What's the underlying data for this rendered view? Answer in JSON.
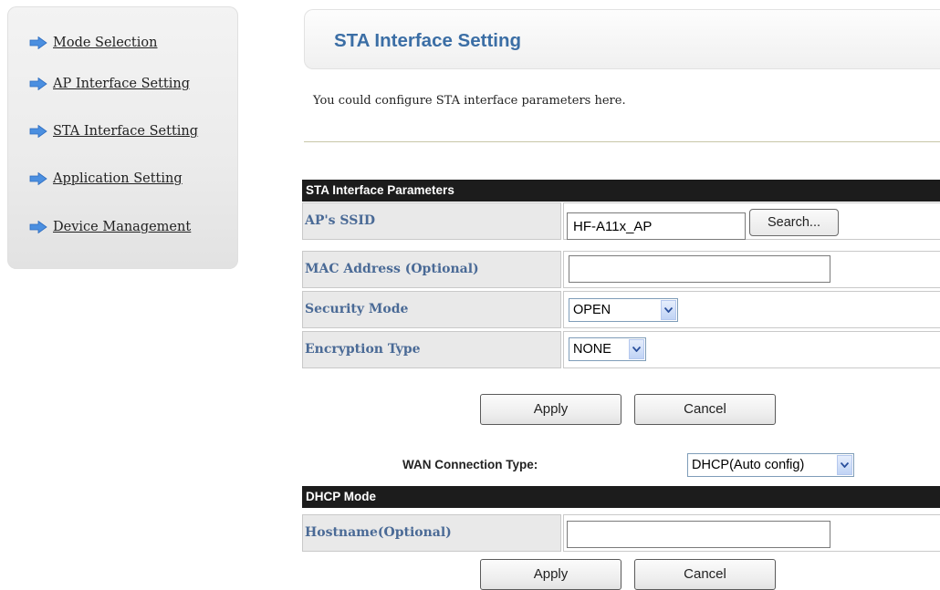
{
  "sidebar": {
    "items": [
      {
        "label": "Mode Selection"
      },
      {
        "label": "AP Interface Setting"
      },
      {
        "label": "STA Interface Setting"
      },
      {
        "label": "Application Setting"
      },
      {
        "label": "Device Management"
      }
    ]
  },
  "header": {
    "title": "STA Interface Setting",
    "description": "You could configure STA interface parameters here."
  },
  "sta_params": {
    "section_title": "STA Interface Parameters",
    "ssid_label": "AP's SSID",
    "ssid_value": "HF-A11x_AP",
    "search_label": "Search...",
    "mac_label": "MAC Address (Optional)",
    "mac_value": "",
    "security_label": "Security Mode",
    "security_value": "OPEN",
    "encryption_label": "Encryption Type",
    "encryption_value": "NONE"
  },
  "actions1": {
    "apply_label": "Apply",
    "cancel_label": "Cancel"
  },
  "wan": {
    "label": "WAN Connection Type:",
    "value": "DHCP(Auto config)"
  },
  "dhcp": {
    "section_title": "DHCP Mode",
    "hostname_label": "Hostname(Optional)",
    "hostname_value": ""
  },
  "actions2": {
    "apply_label": "Apply",
    "cancel_label": "Cancel"
  },
  "colors": {
    "accent": "#3b6ea5",
    "label_text": "#4a6a96",
    "section_header_bg": "#1c1c1c",
    "nav_arrow": "#4b8fe0"
  },
  "icons": {
    "nav_arrow": "arrow-right-icon",
    "dropdown": "chevron-down-icon"
  }
}
